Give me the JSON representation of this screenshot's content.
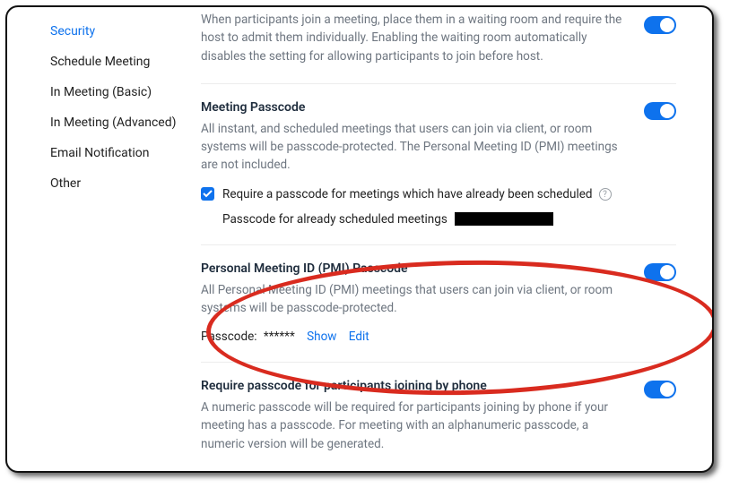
{
  "sidebar": {
    "items": [
      {
        "label": "Security",
        "active": true
      },
      {
        "label": "Schedule Meeting"
      },
      {
        "label": "In Meeting (Basic)"
      },
      {
        "label": "In Meeting (Advanced)"
      },
      {
        "label": "Email Notification"
      },
      {
        "label": "Other"
      }
    ]
  },
  "sections": {
    "waitingRoom": {
      "desc": "When participants join a meeting, place them in a waiting room and require the host to admit them individually. Enabling the waiting room automatically disables the setting for allowing participants to join before host."
    },
    "meetingPasscode": {
      "title": "Meeting Passcode",
      "desc": "All instant, and scheduled meetings that users can join via client, or room systems will be passcode-protected. The Personal Meeting ID (PMI) meetings are not included.",
      "requireLabel": "Require a passcode for meetings which have already been scheduled",
      "alreadyLabel": "Passcode for already scheduled meetings"
    },
    "pmiPasscode": {
      "title": "Personal Meeting ID (PMI) Passcode",
      "desc": "All Personal Meeting ID (PMI) meetings that users can join via client, or room systems will be passcode-protected.",
      "passcodeLabel": "Passcode:",
      "passcodeMasked": "******",
      "showLink": "Show",
      "editLink": "Edit"
    },
    "phonePasscode": {
      "title": "Require passcode for participants joining by phone",
      "desc": "A numeric passcode will be required for participants joining by phone if your meeting has a passcode. For meeting with an alphanumeric passcode, a numeric version will be generated."
    }
  },
  "colors": {
    "accent": "#0e72ed",
    "highlight": "#d92b1f"
  }
}
